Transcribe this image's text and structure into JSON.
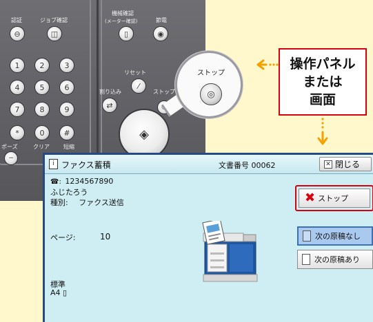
{
  "panel": {
    "labels": {
      "ninsho": "認証",
      "job_kakunin": "ジョブ確認",
      "kikai_kakunin": "機械確認",
      "meter_kakunin": "(メーター確認)",
      "setsuden": "節電",
      "reset": "リセット",
      "warikomi": "割り込み",
      "stop": "ストップ",
      "pause": "ポーズ",
      "clear": "クリア",
      "tanshuku": "短縮"
    },
    "keys": [
      "1",
      "2",
      "3",
      "4",
      "5",
      "6",
      "7",
      "8",
      "9",
      "*",
      "0",
      "#"
    ],
    "zoom_label": "ストップ"
  },
  "callout": {
    "line1": "操作パネル",
    "line2": "または",
    "line3": "画面",
    "border_color": "#d7000f"
  },
  "screen": {
    "title": "ファクス蓄積",
    "doc_number": "文書番号 00062",
    "close_label": "閉じる",
    "tel": "1234567890",
    "recipient": "ふじたろう",
    "type_label": "種別:",
    "type_value": "ファクス送信",
    "pages_label": "ページ:",
    "pages_value": "10",
    "quality": "標準",
    "paper": "A4",
    "stop_label": "ストップ",
    "no_more_label": "次の原稿なし",
    "more_label": "次の原稿あり",
    "accent_color": "#254a86"
  }
}
